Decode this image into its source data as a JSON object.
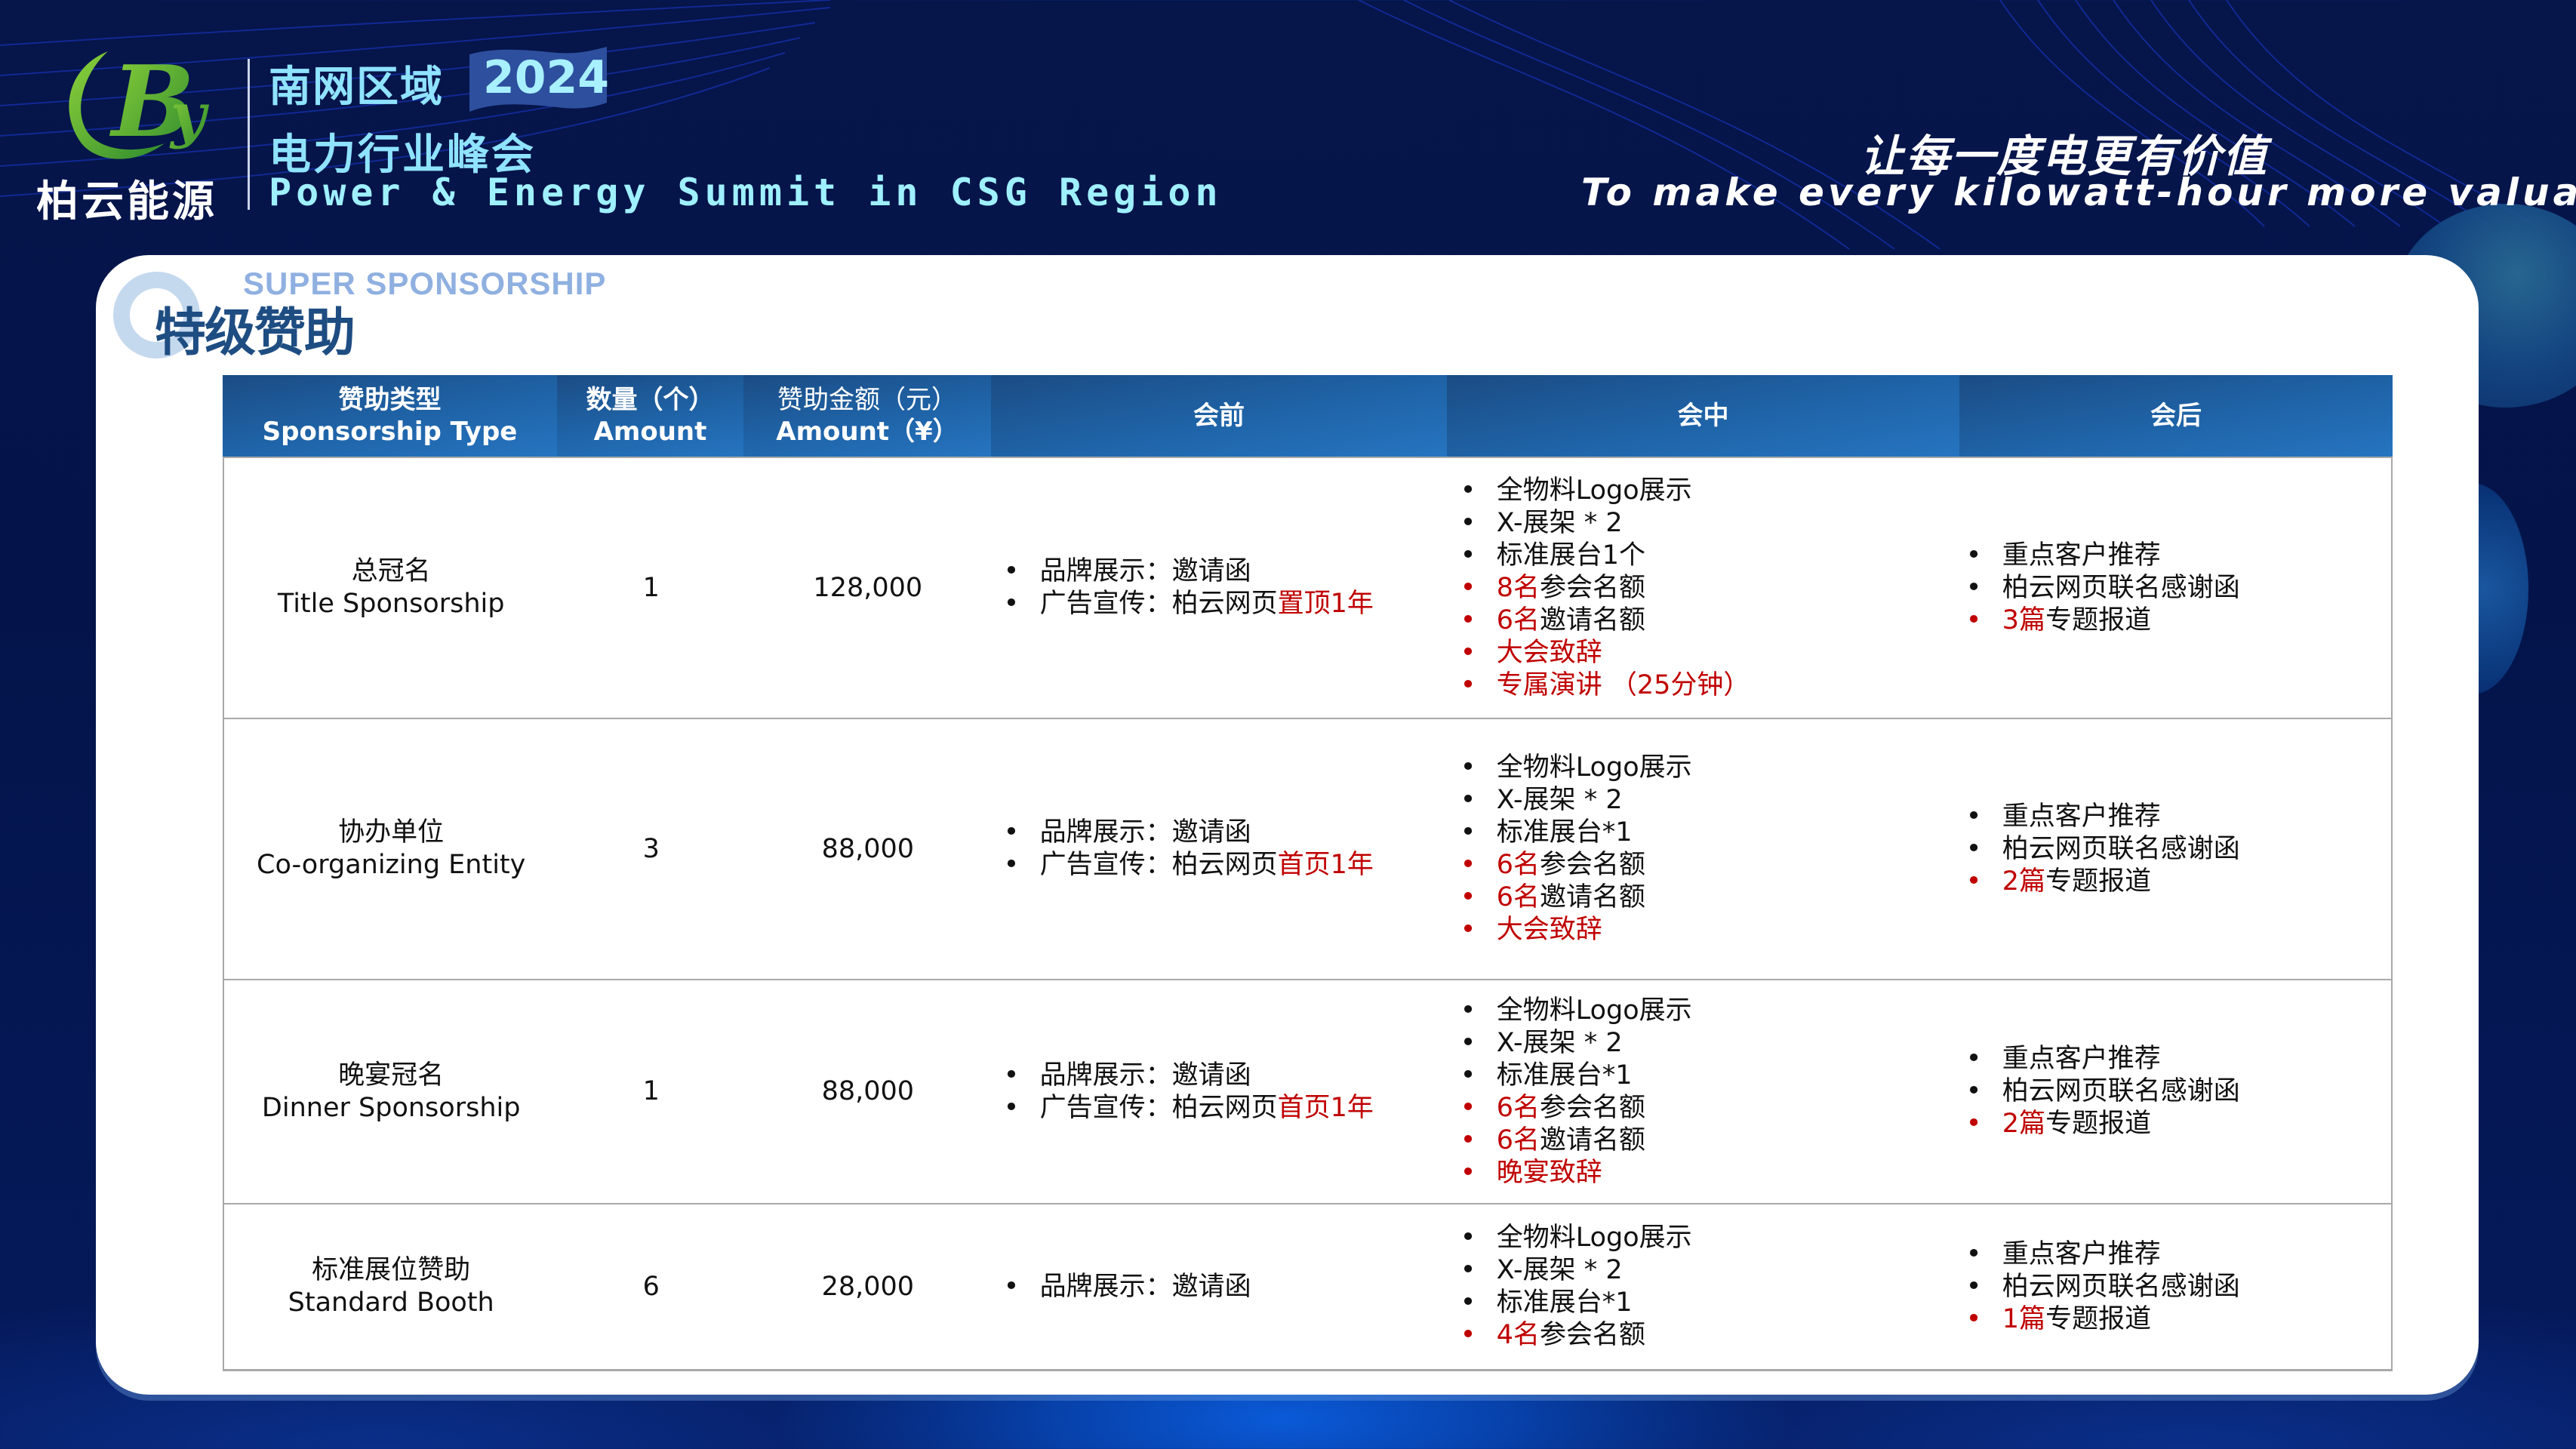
{
  "header": {
    "logo_text": "柏云能源",
    "title_cn_line1": "南网区域",
    "year": "2024",
    "title_cn_line2": "电力行业峰会",
    "title_en": "Power & Energy Summit in CSG Region",
    "slogan_cn": "让每一度电更有价值",
    "slogan_en": "To make every kilowatt-hour more valuable"
  },
  "section": {
    "title_en": "SUPER SPONSORSHIP",
    "title_cn": "特级赞助"
  },
  "colors": {
    "header_cyan": "#8fe3ff",
    "table_header": "#1f64a8",
    "highlight_red": "#c00000",
    "section_title": "#1e4d82"
  },
  "table": {
    "columns": [
      {
        "cn": "赞助类型",
        "en": "Sponsorship Type"
      },
      {
        "cn": "数量（个）",
        "en": "Amount"
      },
      {
        "cn": "赞助金额（元）",
        "en": "Amount（¥）"
      },
      {
        "cn": "会前"
      },
      {
        "cn": "会中"
      },
      {
        "cn": "会后"
      }
    ],
    "rows": [
      {
        "type_cn": "总冠名",
        "type_en": "Title Sponsorship",
        "quantity": "1",
        "price": "128,000",
        "pre": [
          {
            "black": "品牌展示：邀请函",
            "red": ""
          },
          {
            "black": "广告宣传：柏云网页",
            "red": "置顶1年"
          }
        ],
        "during": [
          {
            "red": "",
            "black": "全物料Logo展示"
          },
          {
            "red": "",
            "black": "X-展架 * 2"
          },
          {
            "red": "",
            "black": "标准展台1个"
          },
          {
            "red": "8名",
            "black": "参会名额"
          },
          {
            "red": "6名",
            "black": "邀请名额"
          },
          {
            "red": "大会致辞",
            "black": ""
          },
          {
            "red": "专属演讲 （25分钟）",
            "black": ""
          }
        ],
        "post": [
          {
            "red": "",
            "black": "重点客户推荐"
          },
          {
            "red": "",
            "black": "柏云网页联名感谢函"
          },
          {
            "red": "3篇",
            "black": "专题报道"
          }
        ]
      },
      {
        "type_cn": "协办单位",
        "type_en": "Co-organizing Entity",
        "quantity": "3",
        "price": "88,000",
        "pre": [
          {
            "black": "品牌展示：邀请函",
            "red": ""
          },
          {
            "black": "广告宣传：柏云网页",
            "red": "首页1年"
          }
        ],
        "during": [
          {
            "red": "",
            "black": "全物料Logo展示"
          },
          {
            "red": "",
            "black": "X-展架 * 2"
          },
          {
            "red": "",
            "black": "标准展台*1"
          },
          {
            "red": "6名",
            "black": "参会名额"
          },
          {
            "red": "6名",
            "black": "邀请名额"
          },
          {
            "red": "大会致辞",
            "black": ""
          }
        ],
        "post": [
          {
            "red": "",
            "black": "重点客户推荐"
          },
          {
            "red": "",
            "black": "柏云网页联名感谢函"
          },
          {
            "red": "2篇",
            "black": "专题报道"
          }
        ]
      },
      {
        "type_cn": "晚宴冠名",
        "type_en": "Dinner Sponsorship",
        "quantity": "1",
        "price": "88,000",
        "pre": [
          {
            "black": "品牌展示：邀请函",
            "red": ""
          },
          {
            "black": "广告宣传：柏云网页",
            "red": "首页1年"
          }
        ],
        "during": [
          {
            "red": "",
            "black": "全物料Logo展示"
          },
          {
            "red": "",
            "black": "X-展架 * 2"
          },
          {
            "red": "",
            "black": "标准展台*1"
          },
          {
            "red": "6名",
            "black": "参会名额"
          },
          {
            "red": "6名",
            "black": "邀请名额"
          },
          {
            "red": "晚宴致辞",
            "black": ""
          }
        ],
        "post": [
          {
            "red": "",
            "black": "重点客户推荐"
          },
          {
            "red": "",
            "black": "柏云网页联名感谢函"
          },
          {
            "red": "2篇",
            "black": "专题报道"
          }
        ]
      },
      {
        "type_cn": "标准展位赞助",
        "type_en": "Standard Booth",
        "quantity": "6",
        "price": "28,000",
        "pre": [
          {
            "black": "品牌展示：邀请函",
            "red": ""
          }
        ],
        "during": [
          {
            "red": "",
            "black": "全物料Logo展示"
          },
          {
            "red": "",
            "black": "X-展架 * 2"
          },
          {
            "red": "",
            "black": "标准展台*1"
          },
          {
            "red": "4名",
            "black": "参会名额"
          }
        ],
        "post": [
          {
            "red": "",
            "black": "重点客户推荐"
          },
          {
            "red": "",
            "black": "柏云网页联名感谢函"
          },
          {
            "red": "1篇",
            "black": "专题报道"
          }
        ]
      }
    ]
  }
}
